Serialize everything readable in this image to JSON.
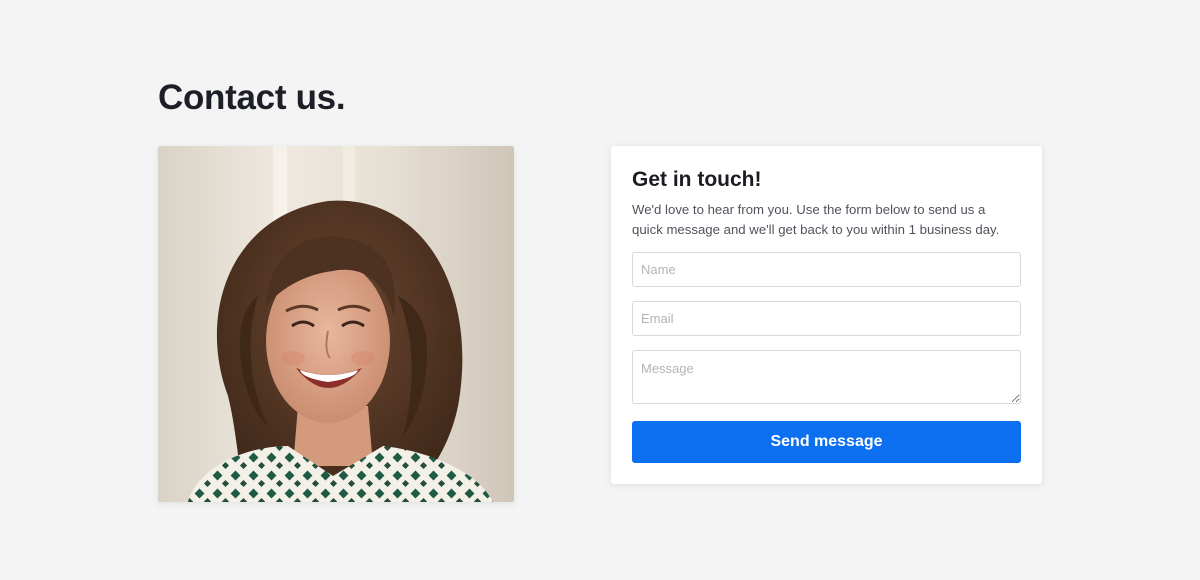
{
  "page": {
    "title": "Contact us."
  },
  "photo": {
    "alt": "Smiling woman with curly brown hair"
  },
  "contact_card": {
    "heading": "Get in touch!",
    "description": "We'd love to hear from you. Use the form below to send us a quick message and we'll get back to you within 1 business day.",
    "fields": {
      "name": {
        "placeholder": "Name",
        "value": ""
      },
      "email": {
        "placeholder": "Email",
        "value": ""
      },
      "message": {
        "placeholder": "Message",
        "value": ""
      }
    },
    "submit_label": "Send message"
  },
  "colors": {
    "background": "#f4f4f4",
    "card": "#ffffff",
    "accent": "#0b6ff0",
    "heading": "#1d1f26",
    "body_text": "#4f535b",
    "placeholder": "#b1b4b9"
  }
}
